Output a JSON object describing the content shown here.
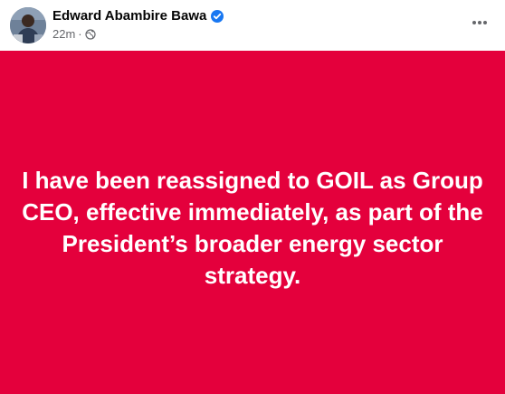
{
  "post": {
    "author": "Edward Abambire Bawa",
    "timestamp": "22m",
    "meta_separator": "·",
    "audience_icon": "globe-icon",
    "more_icon": "ellipsis-icon",
    "verified_icon": "verified-badge-icon",
    "text": "I have been reassigned to GOIL as Group CEO, effective immediately, as part of the President’s broader energy sector strategy.",
    "colors": {
      "background": "#e4003c",
      "text": "#ffffff",
      "verified": "#1877f2"
    }
  }
}
